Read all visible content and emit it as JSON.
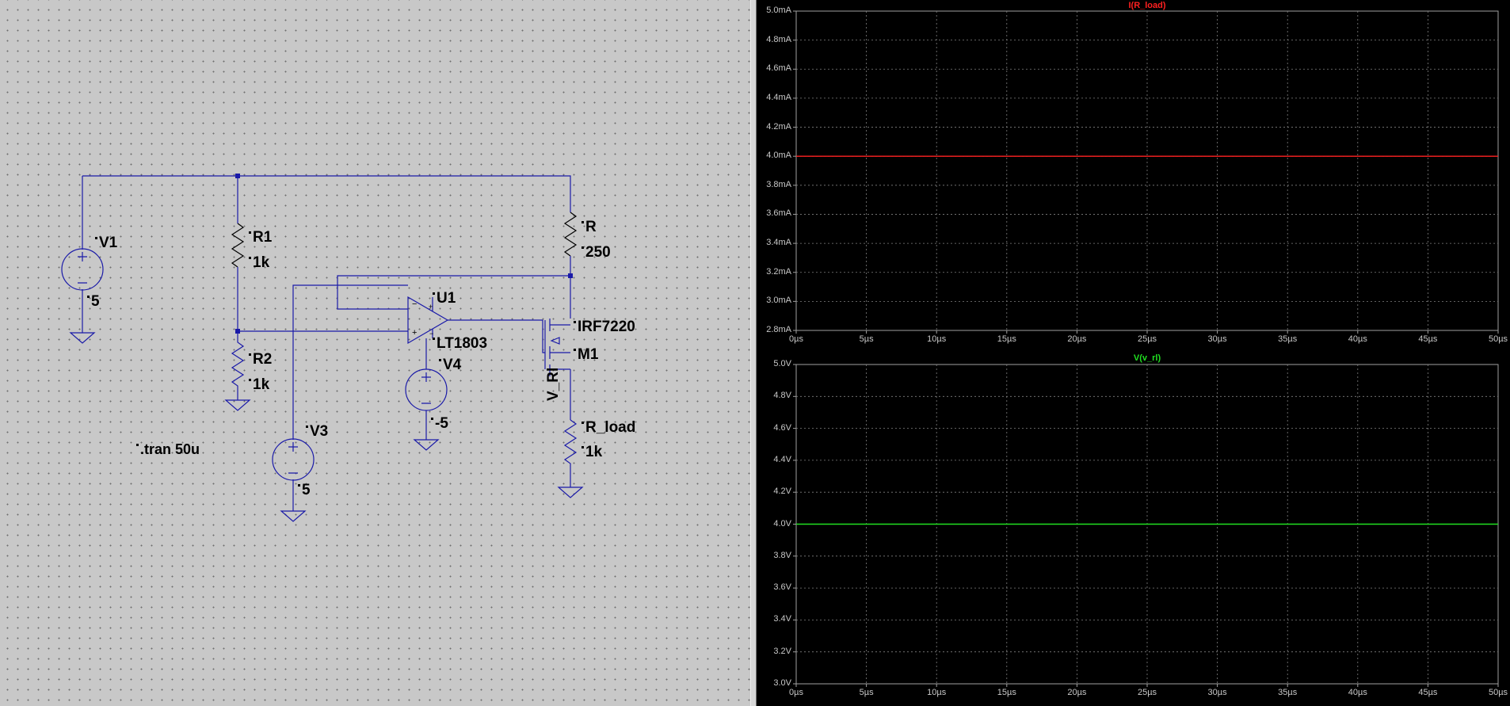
{
  "schematic": {
    "components": [
      {
        "id": "v1",
        "name": "V1",
        "value": "5"
      },
      {
        "id": "r1",
        "name": "R1",
        "value": "1k"
      },
      {
        "id": "r2",
        "name": "R2",
        "value": "1k"
      },
      {
        "id": "u1",
        "name": "U1",
        "value": "LT1803"
      },
      {
        "id": "v4",
        "name": "V4",
        "value": "-5"
      },
      {
        "id": "v3",
        "name": "V3",
        "value": "5"
      },
      {
        "id": "r",
        "name": "R",
        "value": "250"
      },
      {
        "id": "m1",
        "name": "M1",
        "value": "IRF7220"
      },
      {
        "id": "rload",
        "name": "R_load",
        "value": "1k"
      }
    ],
    "net_label": "V_Rl",
    "directive": ".tran 50u"
  },
  "waveforms": {
    "panes": [
      {
        "id": "i-rload",
        "trace_label": "I(R_load)",
        "trace_color": "#ff2020",
        "y_ticks": [
          "5.0mA",
          "4.8mA",
          "4.6mA",
          "4.4mA",
          "4.2mA",
          "4.0mA",
          "3.8mA",
          "3.6mA",
          "3.4mA",
          "3.2mA",
          "3.0mA",
          "2.8mA"
        ],
        "x_ticks": [
          "0µs",
          "5µs",
          "10µs",
          "15µs",
          "20µs",
          "25µs",
          "30µs",
          "35µs",
          "40µs",
          "45µs",
          "50µs"
        ]
      },
      {
        "id": "v-vrl",
        "trace_label": "V(v_rl)",
        "trace_color": "#20e020",
        "y_ticks": [
          "5.0V",
          "4.8V",
          "4.6V",
          "4.4V",
          "4.2V",
          "4.0V",
          "3.8V",
          "3.6V",
          "3.4V",
          "3.2V",
          "3.0V"
        ],
        "x_ticks": [
          "0µs",
          "5µs",
          "10µs",
          "15µs",
          "20µs",
          "25µs",
          "30µs",
          "35µs",
          "40µs",
          "45µs",
          "50µs"
        ]
      }
    ],
    "chart_data": [
      {
        "type": "line",
        "title": "I(R_load)",
        "x": [
          0,
          50
        ],
        "y": [
          4.0,
          4.0
        ],
        "x_unit": "µs",
        "y_unit": "mA",
        "xlim": [
          0,
          50
        ],
        "ylim": [
          2.8,
          5.0
        ],
        "grid": true
      },
      {
        "type": "line",
        "title": "V(v_rl)",
        "x": [
          0,
          50
        ],
        "y": [
          4.0,
          4.0
        ],
        "x_unit": "µs",
        "y_unit": "V",
        "xlim": [
          0,
          50
        ],
        "ylim": [
          3.0,
          5.0
        ],
        "grid": true
      }
    ]
  }
}
